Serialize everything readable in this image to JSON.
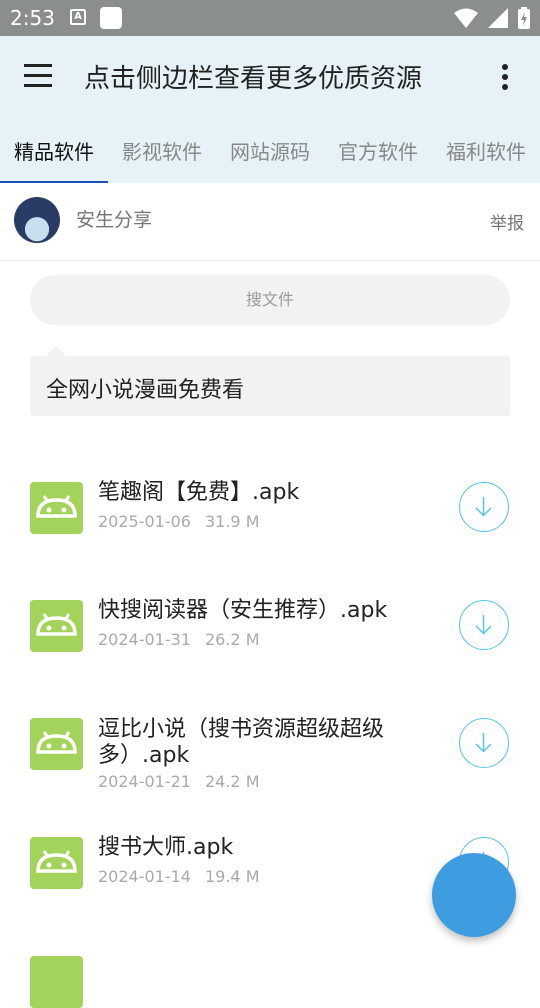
{
  "status_bar": {
    "time": "2:53",
    "a_icon": "A"
  },
  "app_bar": {
    "title": "点击侧边栏查看更多优质资源"
  },
  "tabs": [
    {
      "label": "精品软件",
      "active": true
    },
    {
      "label": "影视软件"
    },
    {
      "label": "网站源码"
    },
    {
      "label": "官方软件"
    },
    {
      "label": "福利软件"
    }
  ],
  "user": {
    "name": "安生分享",
    "report_label": "举报"
  },
  "search": {
    "placeholder": "搜文件"
  },
  "notice": {
    "text": "全网小说漫画免费看"
  },
  "files": [
    {
      "name": "笔趣阁【免费】.apk",
      "date": "2025-01-06",
      "size": "31.9 M"
    },
    {
      "name": "快搜阅读器（安生推荐）.apk",
      "date": "2024-01-31",
      "size": "26.2 M"
    },
    {
      "name": "逗比小说（搜书资源超级超级多）.apk",
      "date": "2024-01-21",
      "size": "24.2 M"
    },
    {
      "name": "搜书大师.apk",
      "date": "2024-01-14",
      "size": "19.4 M"
    }
  ],
  "colors": {
    "appbar_bg": "#e6f2f7",
    "tab_indicator": "#1f4db3",
    "android_green": "#a4d35b",
    "download_ring": "#5bc2ea",
    "fab": "#3d9de0"
  },
  "icons": {
    "menu": "hamburger-menu-icon",
    "more": "more-vert-icon",
    "file": "android-icon",
    "download": "download-icon"
  }
}
